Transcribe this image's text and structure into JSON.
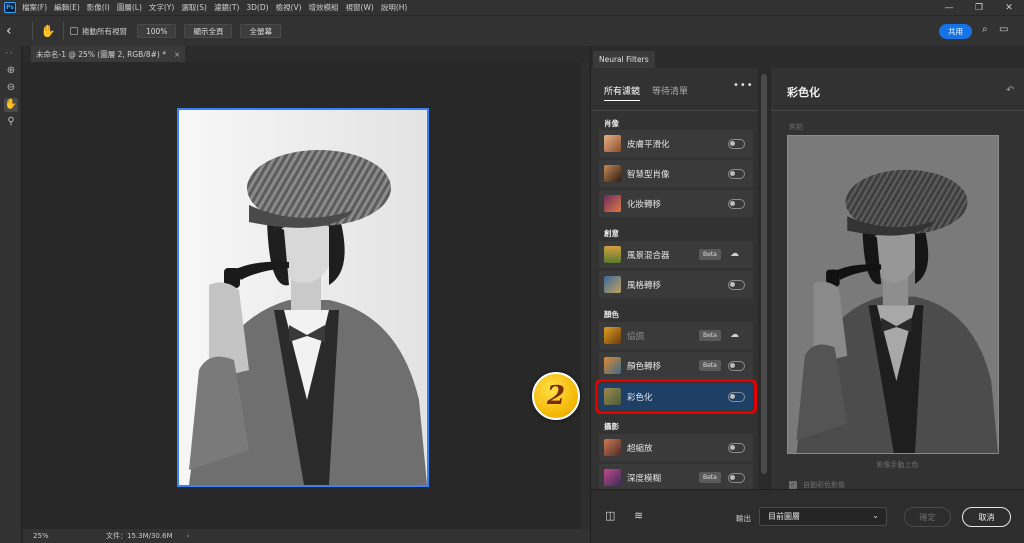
{
  "menubar": {
    "app_icon": "Ps",
    "items": [
      "檔案(F)",
      "編輯(E)",
      "影像(I)",
      "圖層(L)",
      "文字(Y)",
      "選取(S)",
      "濾鏡(T)",
      "3D(D)",
      "檢視(V)",
      "增效模組",
      "視窗(W)",
      "說明(H)"
    ],
    "window_controls": [
      "minimize-icon",
      "restore-icon",
      "close-icon"
    ]
  },
  "options": {
    "scroll_all_label": "捲動所有視窗",
    "zoom_btn": "100%",
    "fit_screen_btn": "顯示全頁",
    "fill_screen_btn": "全螢幕",
    "share_label": "共用"
  },
  "document": {
    "tab_title": "未命名-1 @ 25% (圖層 2, RGB/8#) *",
    "status_zoom": "25%",
    "status_doc": "文件：15.3M/30.6M",
    "marker_number": "2"
  },
  "neural_filters": {
    "panel_tab": "Neural Filters",
    "list_tabs": [
      "所有濾鏡",
      "等待清單"
    ],
    "categories": {
      "portrait": "肖像",
      "creative": "創意",
      "color": "顏色",
      "photography": "攝影"
    },
    "filters": {
      "skin_smoothing": "皮膚平滑化",
      "smart_portrait": "智慧型肖像",
      "makeup_transfer": "化妝轉移",
      "landscape_mixer": "風景混合器",
      "style_transfer": "風格轉移",
      "harmonization": "協調",
      "color_transfer": "顏色轉移",
      "colorize": "彩色化",
      "super_zoom": "超縮放",
      "depth_blur": "深度模糊"
    },
    "beta_label": "Beta",
    "settings": {
      "title": "彩色化",
      "focus_label": "焦點",
      "preview_caption": "影像手動上色",
      "auto_color_label": "自動彩色影像"
    },
    "bottom": {
      "output_label": "輸出",
      "output_value": "目前圖層",
      "ok_label": "確定",
      "cancel_label": "取消"
    }
  },
  "colors": {
    "accent": "#1473e6",
    "selected_filter": "#1e3f66",
    "highlight_box": "#e10000",
    "marker": "#f4b400"
  }
}
